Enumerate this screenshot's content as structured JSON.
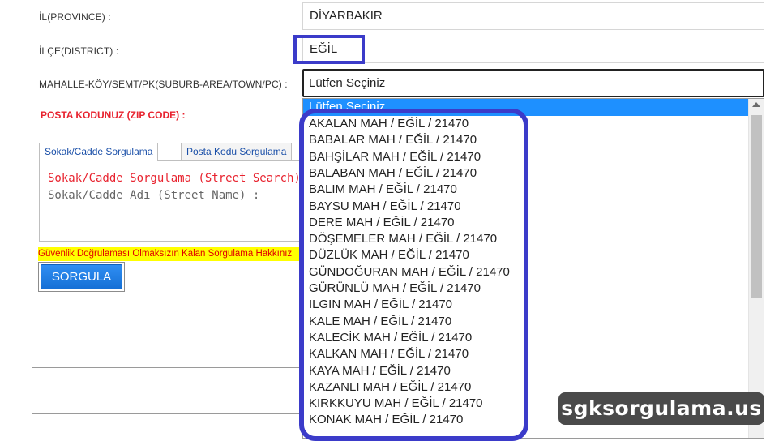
{
  "form": {
    "province_label": "İL(PROVINCE) :",
    "province_value": "DİYARBAKIR",
    "district_label": "İLÇE(DISTRICT) :",
    "district_value": "EĞİL",
    "suburb_label": "MAHALLE-KÖY/SEMT/PK(SUBURB-AREA/TOWN/PC) :",
    "suburb_value": "Lütfen Seçiniz",
    "zip_label": "POSTA KODUNUZ (ZIP CODE) :"
  },
  "dropdown": {
    "selected": "Lütfen Seçiniz",
    "options": [
      "AKALAN MAH / EĞİL / 21470",
      "BABALAR MAH / EĞİL / 21470",
      "BAHŞİLAR MAH / EĞİL / 21470",
      "BALABAN MAH / EĞİL / 21470",
      "BALIM MAH / EĞİL / 21470",
      "BAYSU MAH / EĞİL / 21470",
      "DERE MAH / EĞİL / 21470",
      "DÖŞEMELER MAH / EĞİL / 21470",
      "DÜZLÜK MAH / EĞİL / 21470",
      "GÜNDOĞURAN MAH / EĞİL / 21470",
      "GÜRÜNLÜ MAH / EĞİL / 21470",
      "ILGIN MAH / EĞİL / 21470",
      "KALE MAH / EĞİL / 21470",
      "KALECİK MAH / EĞİL / 21470",
      "KALKAN MAH / EĞİL / 21470",
      "KAYA MAH / EĞİL / 21470",
      "KAZANLI MAH / EĞİL / 21470",
      "KIRKKUYU MAH / EĞİL / 21470",
      "KONAK MAH / EĞİL / 21470"
    ]
  },
  "tabs": {
    "street": "Sokak/Cadde Sorgulama",
    "zip": "Posta Kodu Sorgulama"
  },
  "panel": {
    "title": "Sokak/Cadde Sorgulama (Street Search)",
    "street_label": "Sokak/Cadde Adı (Street Name) :"
  },
  "warning": "Güvenlik Doğrulaması Olmaksızın Kalan Sorgulama Hakkınız",
  "button": "SORGULA",
  "watermark": "sgksorgulama.us",
  "colors": {
    "highlight_frame": "#3b3bc9",
    "selected_option": "#1e90ff",
    "zip_label": "#e8232f",
    "button": "#1670d6",
    "warning_bg": "#ffff00"
  }
}
